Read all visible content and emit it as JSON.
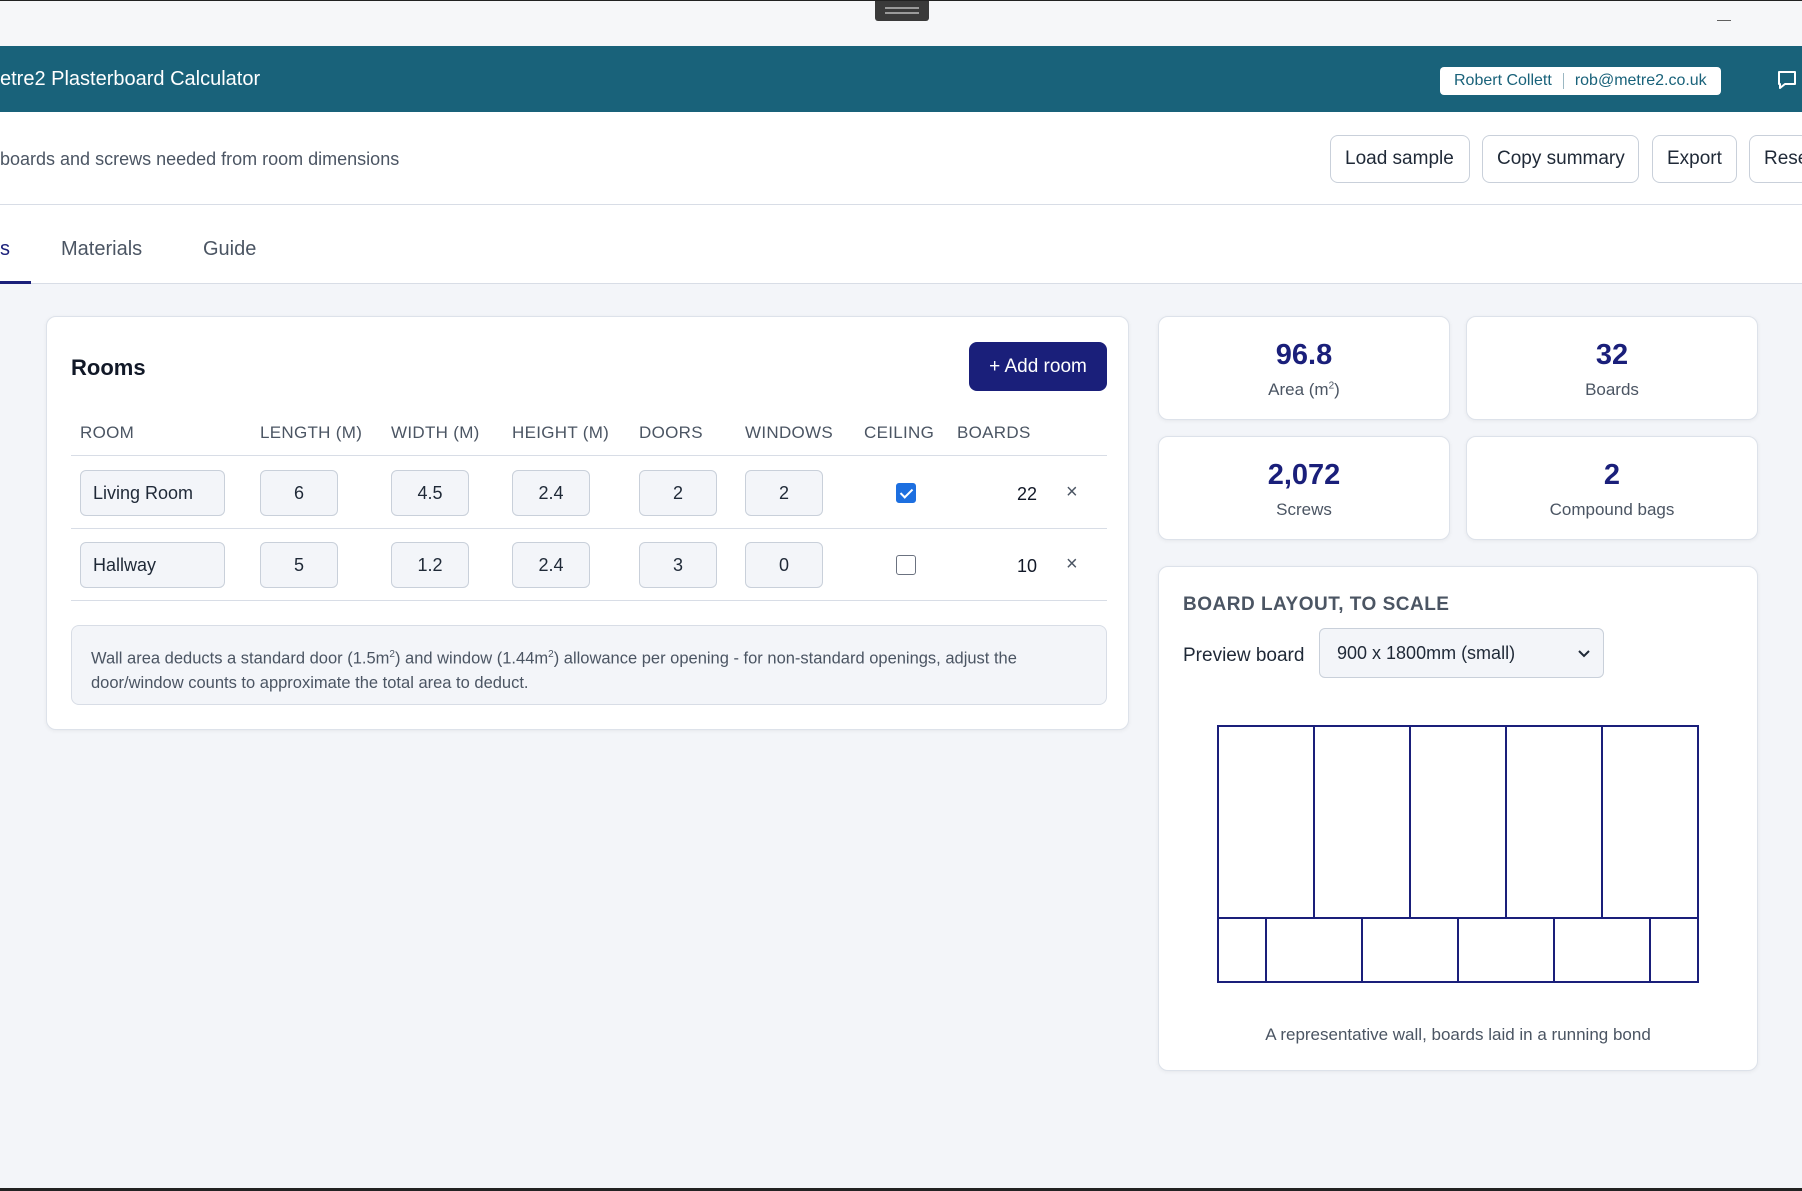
{
  "app": {
    "title": "etre2 Plasterboard Calculator",
    "user_name": "Robert Collett",
    "user_email": "rob@metre2.co.uk"
  },
  "subheader": {
    "subtitle": "boards and screws needed from room dimensions",
    "buttons": {
      "load_sample": "Load sample",
      "copy_summary": "Copy summary",
      "export": "Export",
      "reset": "Reset"
    }
  },
  "tabs": [
    {
      "label": "s",
      "active": true
    },
    {
      "label": "Materials",
      "active": false
    },
    {
      "label": "Guide",
      "active": false
    }
  ],
  "rooms": {
    "title": "Rooms",
    "add_button": "+ Add room",
    "columns": [
      "ROOM",
      "LENGTH (M)",
      "WIDTH (M)",
      "HEIGHT (M)",
      "DOORS",
      "WINDOWS",
      "CEILING",
      "BOARDS"
    ],
    "rows": [
      {
        "name": "Living Room",
        "length": "6",
        "width": "4.5",
        "height": "2.4",
        "doors": "2",
        "windows": "2",
        "ceiling": true,
        "boards": "22",
        "delete": "×"
      },
      {
        "name": "Hallway",
        "length": "5",
        "width": "1.2",
        "height": "2.4",
        "doors": "3",
        "windows": "0",
        "ceiling": false,
        "boards": "10",
        "delete": "×"
      }
    ],
    "note": {
      "part1": "Wall area deducts a standard door (1.5m",
      "part2": ") and window (1.44m",
      "part3": ") allowance per opening - for non-standard openings, adjust the door/window counts to approximate the total area to deduct.",
      "sup": "2"
    }
  },
  "stats": [
    {
      "value": "96.8",
      "label": "Area (m",
      "label_sup": "2",
      "label_end": ")"
    },
    {
      "value": "32",
      "label": "Boards"
    },
    {
      "value": "2,072",
      "label": "Screws"
    },
    {
      "value": "2",
      "label": "Compound bags"
    }
  ],
  "board_layout": {
    "title": "BOARD LAYOUT, TO SCALE",
    "preview_label": "Preview board",
    "selected_board": "900 x 1800mm (small)",
    "caption": "A representative wall, boards laid in a running bond",
    "stroke_color": "#1a1f7a",
    "top_row_boards": 5,
    "bottom_row_full_boards": 4
  }
}
